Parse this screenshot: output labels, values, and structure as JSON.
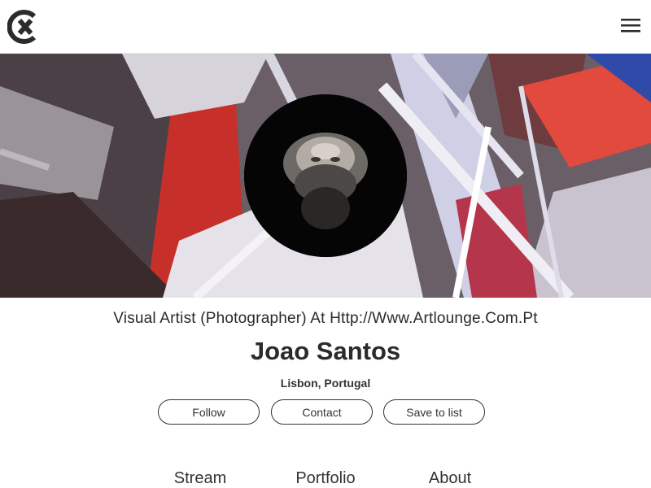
{
  "header": {
    "logo_icon": "circle-x-logo-icon",
    "menu_icon": "hamburger-menu-icon"
  },
  "profile": {
    "headline": "Visual Artist (Photographer) At Http://Www.Artlounge.Com.Pt",
    "name": "Joao Santos",
    "location": "Lisbon, Portugal"
  },
  "actions": {
    "follow": "Follow",
    "contact": "Contact",
    "save": "Save to list"
  },
  "tabs": [
    {
      "label": "Stream"
    },
    {
      "label": "Portfolio"
    },
    {
      "label": "About"
    }
  ],
  "colors": {
    "text": "#333333",
    "background": "#ffffff",
    "avatar_bg": "#050505"
  }
}
